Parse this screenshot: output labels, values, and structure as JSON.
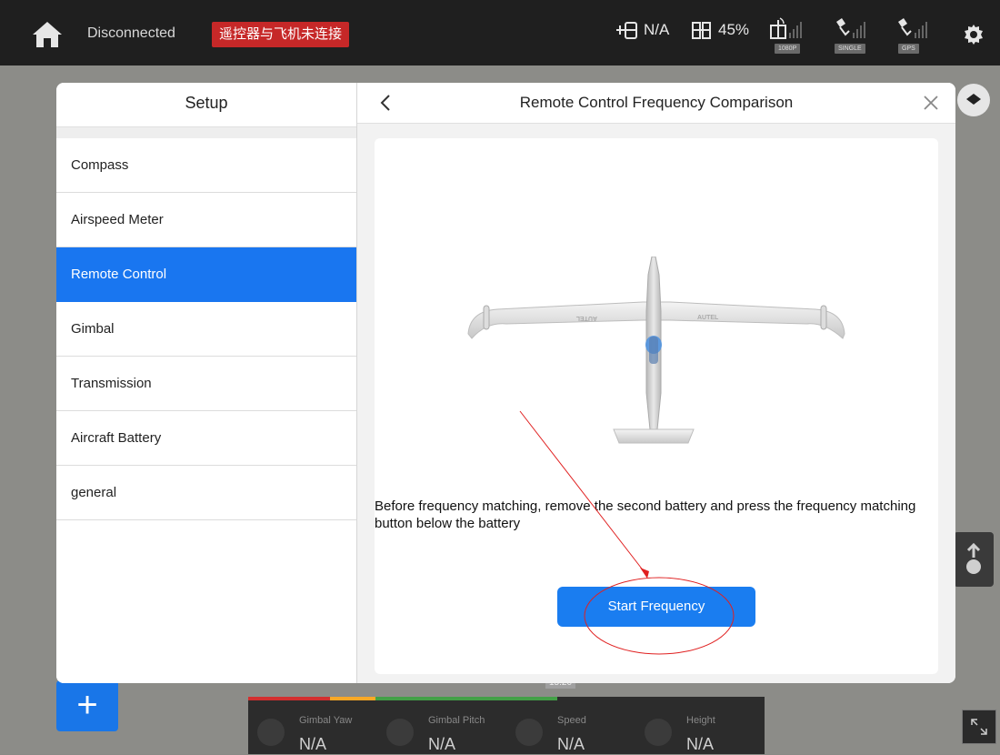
{
  "topbar": {
    "connection_status": "Disconnected",
    "alert_text": "遥控器与飞机未连接",
    "rc_signal": "N/A",
    "rc_battery": "45%",
    "badge_video": "1080P",
    "badge_mode": "SINGLE",
    "badge_gps": "GPS"
  },
  "dialog": {
    "sidebar": {
      "title": "Setup",
      "items": [
        {
          "label": "Compass"
        },
        {
          "label": "Airspeed Meter"
        },
        {
          "label": "Remote Control"
        },
        {
          "label": "Gimbal"
        },
        {
          "label": "Transmission"
        },
        {
          "label": "Aircraft Battery"
        },
        {
          "label": "general"
        }
      ],
      "active_index": 2
    },
    "panel": {
      "title": "Remote Control Frequency Comparison",
      "plane_brand_left": "AUTEL",
      "plane_brand_right": "AUTEL",
      "instruction": "Before frequency matching, remove the second battery and press the frequency matching button below the battery",
      "start_button": "Start Frequency"
    }
  },
  "telemetry": {
    "time": "15:20",
    "items": [
      {
        "label": "Gimbal Yaw",
        "value": "N/A"
      },
      {
        "label": "Gimbal Pitch",
        "value": "N/A"
      },
      {
        "label": "Speed",
        "value": "N/A"
      },
      {
        "label": "Height",
        "value": "N/A"
      }
    ]
  },
  "colors": {
    "accent": "#1976f0",
    "alert": "#c62828",
    "annotation": "#e02020"
  }
}
